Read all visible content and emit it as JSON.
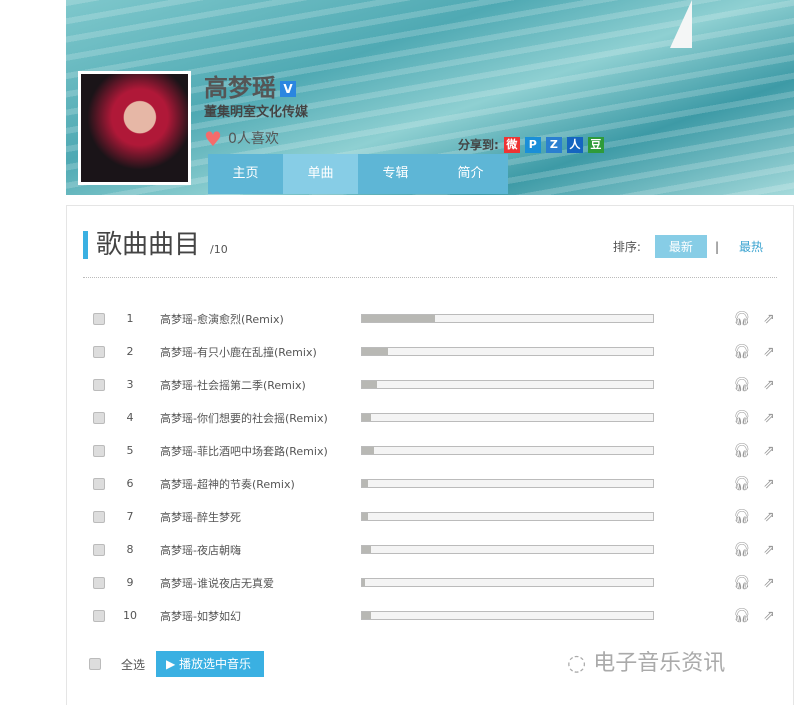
{
  "artist": {
    "name": "高梦瑶",
    "verified": "V",
    "company": "董集明室文化传媒",
    "likes": "0人喜欢"
  },
  "share": {
    "label": "分享到:",
    "icons": [
      "weibo-icon",
      "p-icon",
      "qzone-icon",
      "renren-icon",
      "douban-icon"
    ],
    "glyphs": [
      "微",
      "P",
      "Z",
      "人",
      "豆"
    ],
    "colors": [
      "#e33",
      "#1a8fd8",
      "#2a7fd0",
      "#1565c0",
      "#2e9b3a"
    ]
  },
  "tabs": [
    "主页",
    "单曲",
    "专辑",
    "简介"
  ],
  "active_tab": "单曲",
  "section": {
    "title": "歌曲曲目",
    "count": "/10",
    "sort_label": "排序:",
    "sort_options": [
      "最新",
      "最热"
    ],
    "divider": "|"
  },
  "songs": [
    {
      "no": "1",
      "title": "高梦瑶-愈演愈烈(Remix)",
      "popularity": 25
    },
    {
      "no": "2",
      "title": "高梦瑶-有只小鹿在乱撞(Remix)",
      "popularity": 9
    },
    {
      "no": "3",
      "title": "高梦瑶-社会摇第二季(Remix)",
      "popularity": 5
    },
    {
      "no": "4",
      "title": "高梦瑶-你们想要的社会摇(Remix)",
      "popularity": 3
    },
    {
      "no": "5",
      "title": "高梦瑶-菲比酒吧中场套路(Remix)",
      "popularity": 4
    },
    {
      "no": "6",
      "title": "高梦瑶-超神的节奏(Remix)",
      "popularity": 2
    },
    {
      "no": "7",
      "title": "高梦瑶-醉生梦死",
      "popularity": 2
    },
    {
      "no": "8",
      "title": "高梦瑶-夜店朝嗨",
      "popularity": 3
    },
    {
      "no": "9",
      "title": "高梦瑶-谁说夜店无真爱",
      "popularity": 1
    },
    {
      "no": "10",
      "title": "高梦瑶-如梦如幻",
      "popularity": 3
    }
  ],
  "footer": {
    "select_all": "全选",
    "play_button": "播放选中音乐",
    "watermark": "电子音乐资讯"
  }
}
